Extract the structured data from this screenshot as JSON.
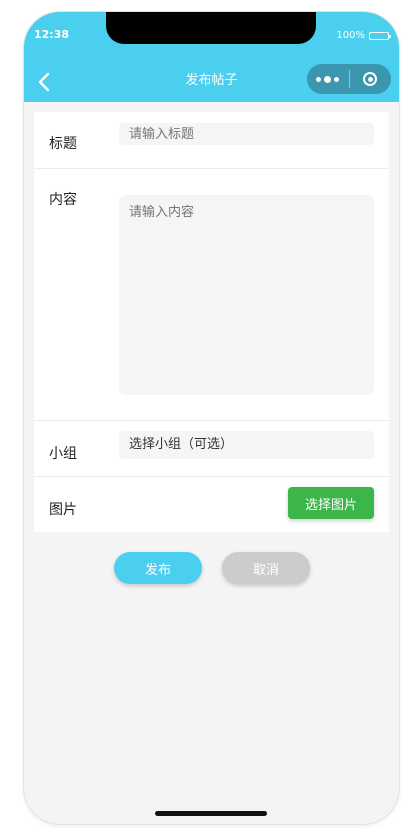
{
  "status_bar": {
    "time": "12:38",
    "battery": "100%"
  },
  "header": {
    "title": "发布帖子",
    "icons": {
      "back": "chevron-left-icon",
      "more": "more-dots-icon",
      "close": "target-circle-icon"
    }
  },
  "form": {
    "title_label": "标题",
    "title_placeholder": "请输入标题",
    "content_label": "内容",
    "content_placeholder": "请输入内容",
    "group_label": "小组",
    "group_value": "选择小组（可选）",
    "image_label": "图片",
    "choose_image": "选择图片"
  },
  "actions": {
    "publish": "发布",
    "cancel": "取消"
  },
  "colors": {
    "primary": "#4bcfee",
    "success": "#3cb54a",
    "disabled": "#cccccc",
    "background": "#f4f4f4"
  }
}
